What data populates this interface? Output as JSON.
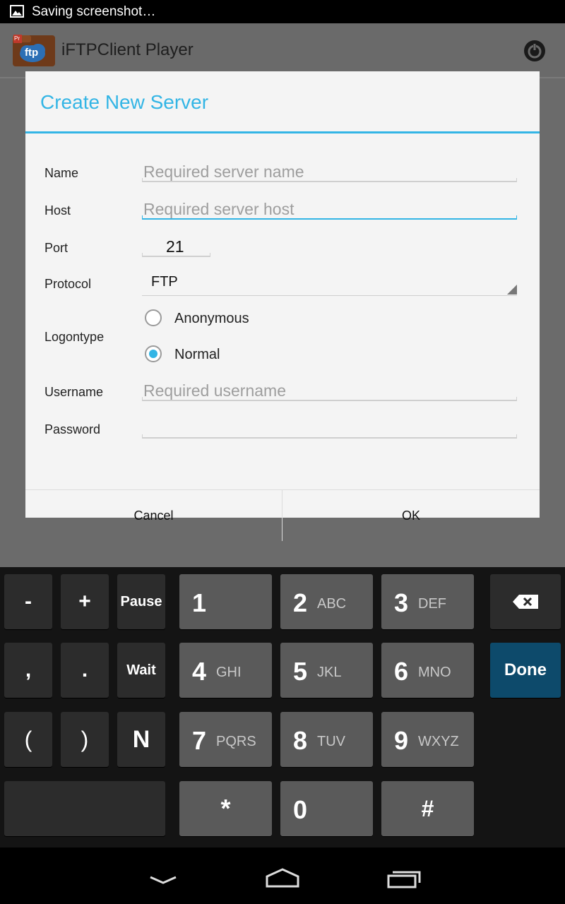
{
  "status_bar": {
    "text": "Saving screenshot…",
    "icon": "image-icon"
  },
  "action_bar": {
    "title": "iFTPClient Player",
    "logo_text": "ftp",
    "logo_badge": "Pr",
    "right_icon": "power-icon"
  },
  "dialog": {
    "title": "Create New Server",
    "fields": {
      "name": {
        "label": "Name",
        "placeholder": "Required server name",
        "value": ""
      },
      "host": {
        "label": "Host",
        "placeholder": "Required server host",
        "value": ""
      },
      "port": {
        "label": "Port",
        "value": "21"
      },
      "protocol": {
        "label": "Protocol",
        "selected": "FTP"
      },
      "logontype": {
        "label": "Logontype",
        "options": [
          "Anonymous",
          "Normal"
        ],
        "selected": "Normal"
      },
      "username": {
        "label": "Username",
        "placeholder": "Required username",
        "value": ""
      },
      "password": {
        "label": "Password",
        "value": ""
      }
    },
    "buttons": {
      "cancel": "Cancel",
      "ok": "OK"
    }
  },
  "keyboard": {
    "rows": [
      [
        {
          "label": "-",
          "kind": "symbol"
        },
        {
          "label": "+",
          "kind": "symbol"
        },
        {
          "label": "Pause",
          "kind": "symbol"
        },
        {
          "digit": "1",
          "letters": "",
          "kind": "num"
        },
        {
          "digit": "2",
          "letters": "ABC",
          "kind": "num"
        },
        {
          "digit": "3",
          "letters": "DEF",
          "kind": "num"
        },
        {
          "icon": "backspace-icon",
          "kind": "action"
        }
      ],
      [
        {
          "label": ",",
          "kind": "symbol"
        },
        {
          "label": ".",
          "kind": "symbol"
        },
        {
          "label": "Wait",
          "kind": "symbol"
        },
        {
          "digit": "4",
          "letters": "GHI",
          "kind": "num"
        },
        {
          "digit": "5",
          "letters": "JKL",
          "kind": "num"
        },
        {
          "digit": "6",
          "letters": "MNO",
          "kind": "num"
        },
        {
          "label": "Done",
          "kind": "done"
        }
      ],
      [
        {
          "label": "(",
          "kind": "symbol"
        },
        {
          "label": ")",
          "kind": "symbol"
        },
        {
          "label": "N",
          "kind": "symbol"
        },
        {
          "digit": "7",
          "letters": "PQRS",
          "kind": "num"
        },
        {
          "digit": "8",
          "letters": "TUV",
          "kind": "num"
        },
        {
          "digit": "9",
          "letters": "WXYZ",
          "kind": "num"
        }
      ],
      [
        {
          "label": "",
          "kind": "space"
        },
        {
          "label": "*",
          "kind": "num"
        },
        {
          "digit": "0",
          "letters": "",
          "kind": "num"
        },
        {
          "label": "#",
          "kind": "num"
        }
      ]
    ]
  },
  "nav_bar": {
    "buttons": [
      "back-icon",
      "home-icon",
      "recents-icon"
    ]
  }
}
